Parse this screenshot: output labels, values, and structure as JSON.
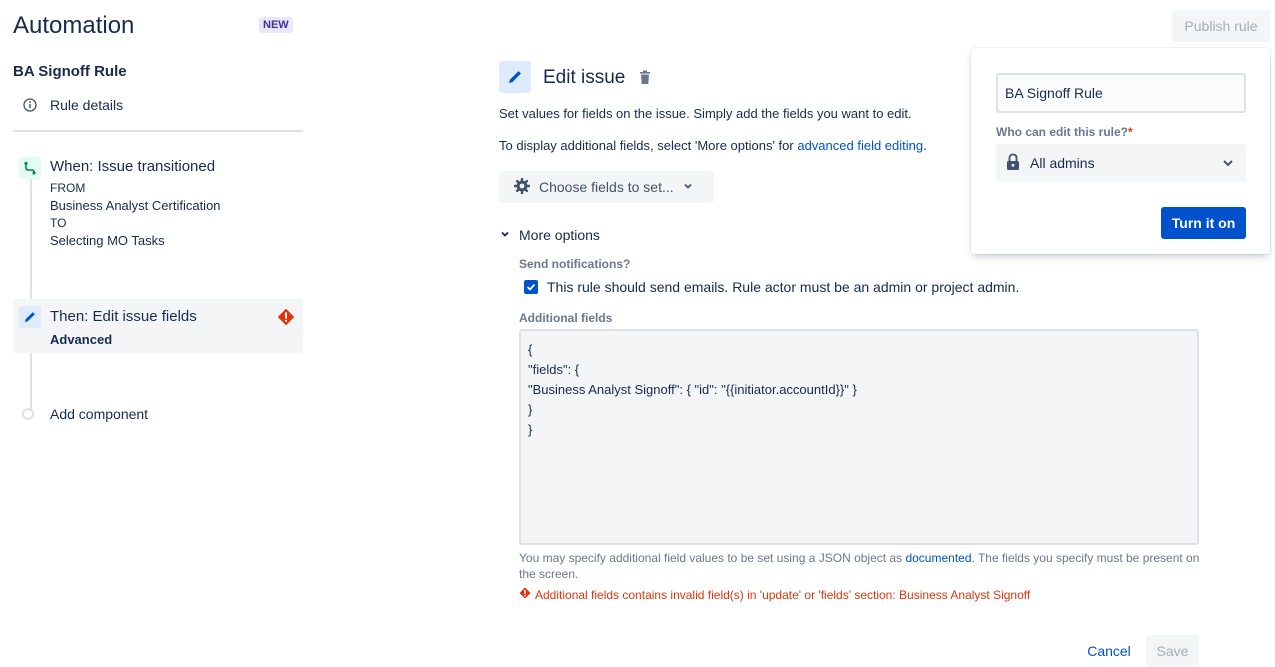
{
  "header": {
    "title": "Automation",
    "badge": "NEW",
    "publish_label": "Publish rule"
  },
  "sidebar": {
    "rule_name": "BA Signoff Rule",
    "rule_details_label": "Rule details",
    "trigger": {
      "title": "When: Issue transitioned",
      "from_label": "FROM",
      "from_value": "Business Analyst Certification",
      "to_label": "TO",
      "to_value": "Selecting MO Tasks"
    },
    "action": {
      "title": "Then: Edit issue fields",
      "subtitle": "Advanced"
    },
    "add_component_label": "Add component"
  },
  "main": {
    "title": "Edit issue",
    "description": "Set values for fields on the issue. Simply add the fields you want to edit.",
    "description2_prefix": "To display additional fields, select 'More options' for ",
    "description2_link": "advanced field editing",
    "description2_suffix": ".",
    "choose_fields_label": "Choose fields to set...",
    "more_options_label": "More options",
    "send_notifications_label": "Send notifications?",
    "send_emails_text": "This rule should send emails. Rule actor must be an admin or project admin.",
    "send_emails_checked": true,
    "additional_fields_label": "Additional fields",
    "json_lines": [
      "{",
      "\"fields\": {",
      "\"Business Analyst Signoff\": { \"id\": \"{{initiator.accountId}}\" }",
      "}",
      "}"
    ],
    "help_prefix": "You may specify additional field values to be set using a JSON object as ",
    "help_link": "documented",
    "help_suffix": ". The fields you specify must be present on the screen.",
    "error_text": "Additional fields contains invalid field(s) in 'update' or 'fields' section: Business Analyst Signoff",
    "cancel_label": "Cancel",
    "save_label": "Save"
  },
  "popover": {
    "name_value": "BA Signoff Rule",
    "who_label": "Who can edit this rule?",
    "required_marker": "*",
    "admins_value": "All admins",
    "turn_on_label": "Turn it on"
  },
  "colors": {
    "primary": "#0052cc",
    "error": "#de350b",
    "trigger_green": "#00875a",
    "new_badge_bg": "#eae6ff"
  }
}
